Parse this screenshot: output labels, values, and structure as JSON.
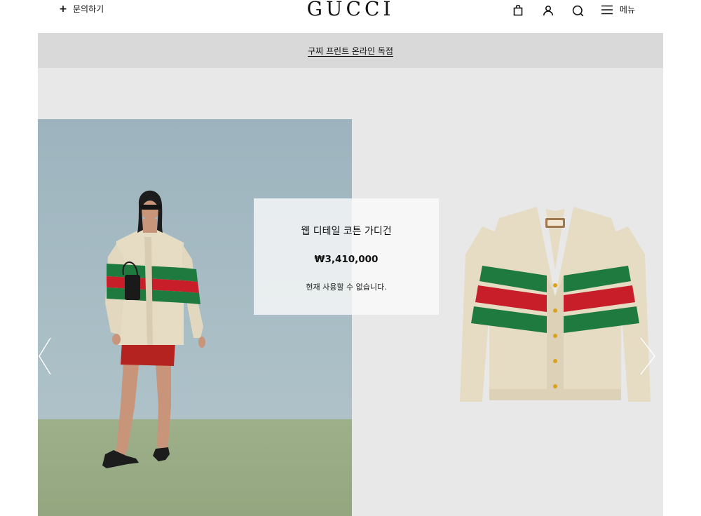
{
  "header": {
    "contact_icon": "+",
    "contact_label": "문의하기",
    "logo": "GUCCI",
    "icons": [
      "shopping-bag-icon",
      "user-icon",
      "search-icon",
      "menu-icon"
    ],
    "menu_label": "메뉴"
  },
  "promo": {
    "text": "구찌 프린트 온라인 독점"
  },
  "product": {
    "name": "웹 디테일 코튼 가디건",
    "price": "₩3,410,000",
    "status": "현재 사용할 수 없습니다.",
    "colors": {
      "cream": "#e6dcc4",
      "green": "#1f7a3f",
      "red": "#c81e2a",
      "skirt": "#b4231f"
    }
  }
}
